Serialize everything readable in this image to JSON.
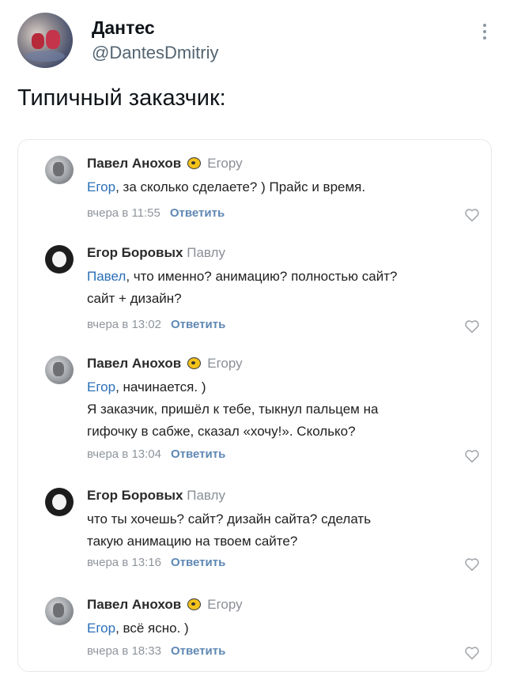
{
  "tweet": {
    "author_name": "Дантес",
    "author_handle": "@DantesDmitriy",
    "text": "Типичный заказчик:"
  },
  "comments": [
    {
      "author": "Павел Анохов",
      "reply_to": "Егору",
      "mention": "Егор",
      "lines": [
        ", за сколько сделаете? ) Прайс и время."
      ],
      "time": "вчера в 11:55",
      "reply_label": "Ответить"
    },
    {
      "author": "Егор Боровых",
      "reply_to": "Павлу",
      "mention": "Павел",
      "lines": [
        ", что именно? анимацию? полностью сайт?",
        "сайт + дизайн?"
      ],
      "time": "вчера в 13:02",
      "reply_label": "Ответить"
    },
    {
      "author": "Павел Анохов",
      "reply_to": "Егору",
      "mention": "Егор",
      "lines": [
        ", начинается. )",
        "Я заказчик, пришёл к тебе, тыкнул пальцем на",
        "гифочку в сабже, сказал «хочу!». Сколько?"
      ],
      "time": "вчера в 13:04",
      "reply_label": "Ответить"
    },
    {
      "author": "Егор Боровых",
      "reply_to": "Павлу",
      "mention": "",
      "lines": [
        "что ты хочешь? сайт? дизайн сайта? сделать",
        "такую анимацию на твоем сайте?"
      ],
      "time": "вчера в 13:16",
      "reply_label": "Ответить"
    },
    {
      "author": "Павел Анохов",
      "reply_to": "Егору",
      "mention": "Егор",
      "lines": [
        ", всё ясно. )"
      ],
      "time": "вчера в 18:33",
      "reply_label": "Ответить"
    }
  ]
}
